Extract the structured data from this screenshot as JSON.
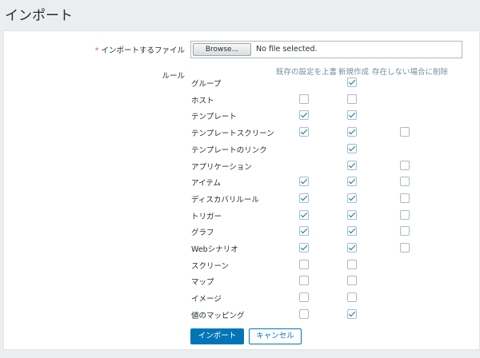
{
  "page": {
    "title": "インポート"
  },
  "file_field": {
    "required_mark": "*",
    "label": "インポートするファイル",
    "browse_label": "Browse...",
    "status": "No file selected."
  },
  "rules": {
    "label": "ルール",
    "columns": {
      "update_existing": "既存の設定を上書",
      "create_new": "新規作成",
      "delete_missing": "存在しない場合に削除"
    },
    "items": [
      {
        "name": "グループ",
        "update": null,
        "create": true,
        "delete": null
      },
      {
        "name": "ホスト",
        "update": false,
        "create": false,
        "delete": null
      },
      {
        "name": "テンプレート",
        "update": true,
        "create": true,
        "delete": null
      },
      {
        "name": "テンプレートスクリーン",
        "update": true,
        "create": true,
        "delete": false
      },
      {
        "name": "テンプレートのリンク",
        "update": null,
        "create": true,
        "delete": null
      },
      {
        "name": "アプリケーション",
        "update": null,
        "create": true,
        "delete": false
      },
      {
        "name": "アイテム",
        "update": true,
        "create": true,
        "delete": false
      },
      {
        "name": "ディスカバリルール",
        "update": true,
        "create": true,
        "delete": false
      },
      {
        "name": "トリガー",
        "update": true,
        "create": true,
        "delete": false
      },
      {
        "name": "グラフ",
        "update": true,
        "create": true,
        "delete": false
      },
      {
        "name": "Webシナリオ",
        "update": true,
        "create": true,
        "delete": false
      },
      {
        "name": "スクリーン",
        "update": false,
        "create": false,
        "delete": null
      },
      {
        "name": "マップ",
        "update": false,
        "create": false,
        "delete": null
      },
      {
        "name": "イメージ",
        "update": false,
        "create": false,
        "delete": null
      },
      {
        "name": "値のマッピング",
        "update": false,
        "create": true,
        "delete": null
      }
    ]
  },
  "actions": {
    "import_label": "インポート",
    "cancel_label": "キャンセル"
  },
  "colors": {
    "accent": "#0275b8",
    "required": "#e45959",
    "header_text": "#768d99"
  }
}
